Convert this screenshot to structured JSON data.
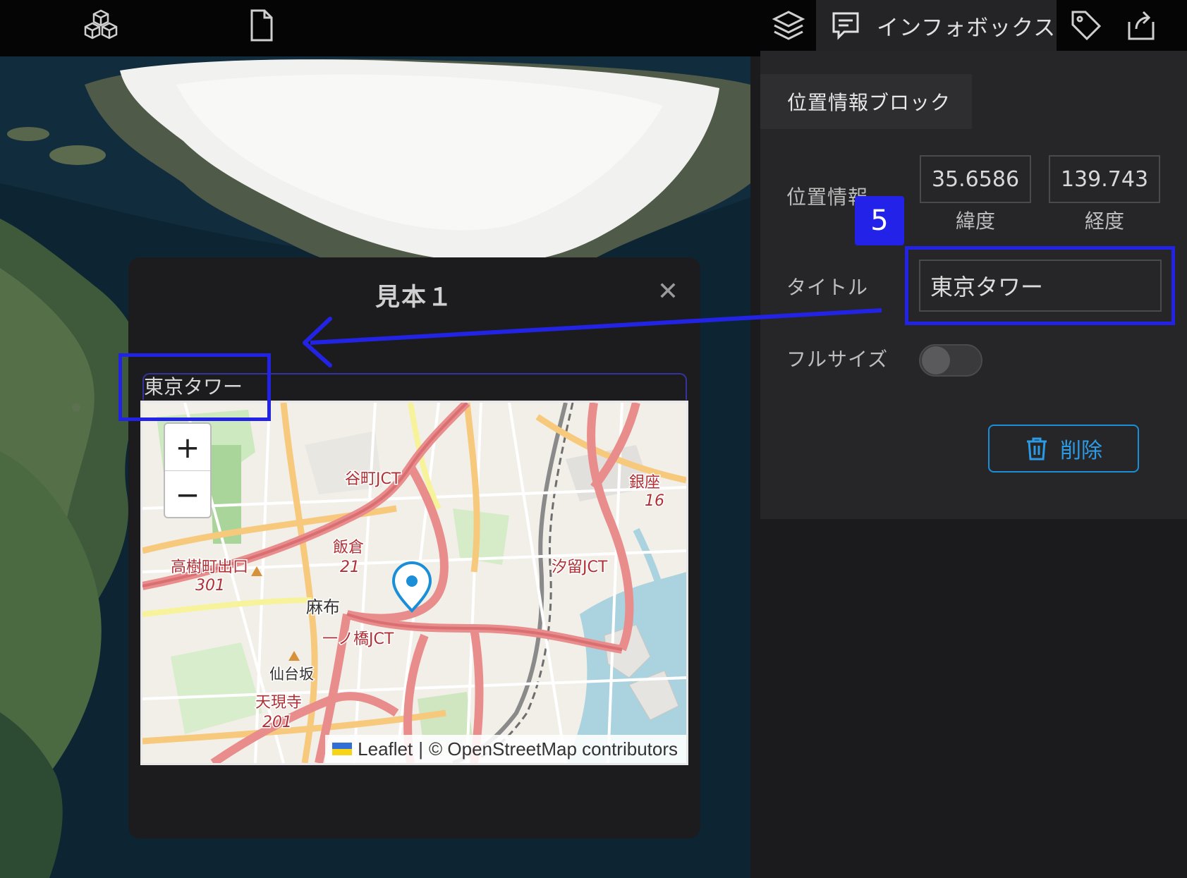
{
  "toolbar": {
    "icons": [
      "cubes-icon",
      "file-icon",
      "layers-icon",
      "infobox-icon",
      "tag-icon",
      "export-icon"
    ],
    "active_tab_label": "インフォボックス"
  },
  "panel": {
    "section_tab": "位置情報ブロック",
    "location_label": "位置情報",
    "latitude_value": "35.6586",
    "latitude_caption": "緯度",
    "longitude_value": "139.743",
    "longitude_caption": "経度",
    "title_label": "タイトル",
    "title_value": "東京タワー",
    "fullsize_label": "フルサイズ",
    "fullsize_on": false,
    "delete_label": "削除"
  },
  "annotation": {
    "step_number": "5",
    "color": "#2323e6"
  },
  "popup": {
    "heading": "見本１",
    "close_symbol": "✕",
    "block_title": "東京タワー",
    "map": {
      "zoom_in": "+",
      "zoom_out": "−",
      "attribution_leaflet": "Leaflet",
      "attribution_sep": "|",
      "attribution_osm": "© OpenStreetMap contributors",
      "labels": {
        "tanimachi": "谷町JCT",
        "iikura": "飯倉",
        "iikura_num": "21",
        "takagi": "高樹町出口",
        "takagi_num": "301",
        "azabu": "麻布",
        "ichinohashi": "一ノ橋JCT",
        "sendaizaka": "仙台坂",
        "tengenji": "天現寺",
        "tengenji_num": "201",
        "ginza": "銀座",
        "ginza_num": "16",
        "shiodome": "汐留JCT"
      }
    }
  },
  "colors": {
    "accent_blue": "#1a8fd8",
    "annotation_blue": "#2323e6",
    "marker": "#1a8fd8"
  }
}
